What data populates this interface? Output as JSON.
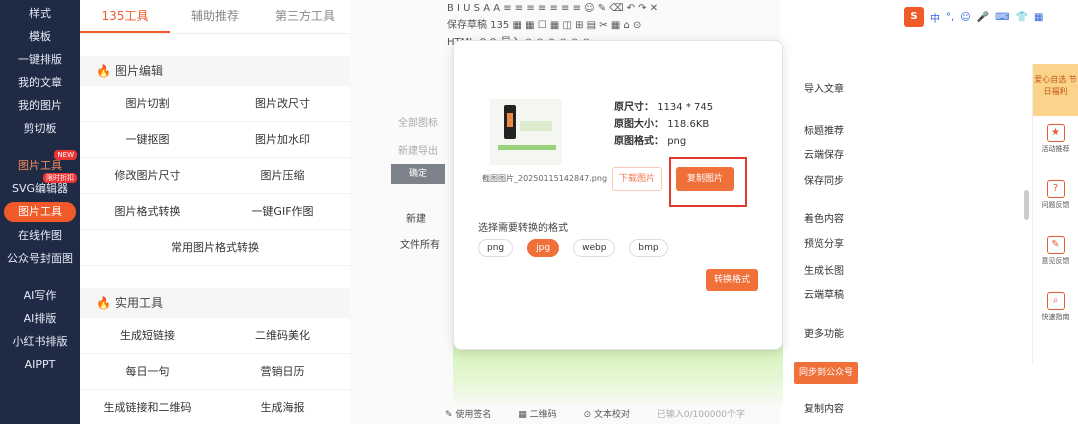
{
  "sidebar": {
    "items_top": [
      "样式",
      "模板",
      "一键排版",
      "我的文章",
      "我的图片",
      "剪切板"
    ],
    "item_hot": "图片工具",
    "badge_hot": "NEW",
    "item_svg": "SVG编辑器",
    "badge_svg": "限时折扣",
    "item_active": "图片工具",
    "item_after": [
      "在线作图",
      "公众号封面图"
    ],
    "items_bottom": [
      "AI写作",
      "AI排版",
      "小红书排版",
      "AIPPT"
    ]
  },
  "tools_panel": {
    "tabs": [
      "135工具",
      "辅助推荐",
      "第三方工具"
    ],
    "section_image": "图片编辑",
    "image_tools": [
      "图片切割",
      "图片改尺寸",
      "一键抠图",
      "图片加水印",
      "修改图片尺寸",
      "图片压缩",
      "图片格式转换",
      "一键GIF作图"
    ],
    "image_tools_wide": "常用图片格式转换",
    "section_practical": "实用工具",
    "practical_tools": [
      "生成短链接",
      "二维码美化",
      "每日一句",
      "营销日历",
      "生成链接和二维码",
      "生成海报"
    ]
  },
  "toolbar": {
    "row1": "B  I  U  S  A  A  ≡  ≡  ≡  ≡  ≡  ≡  ≡  ☺  ✎  ⌫  ↶  ↷  ✕",
    "row2": "保存草稿  135  ▦  ▦  ☐  ▦  ◫  ⊞  ▤  ✂  ▦  ⌂  ⊙",
    "row3": "HTML  ↶  ↷  导入  ⊙  ⊙  ⊕  ⊗  ⊘  ⊙"
  },
  "editor_side": {
    "faint1": "全部图标",
    "faint2": "新建导出",
    "gray_button": "确定",
    "label1": "新建",
    "label2": "文件所有"
  },
  "dialog": {
    "image_filename": "截图图片_20250115142847.png",
    "size_label": "原尺寸：",
    "size_value": "1134 * 745",
    "filesize_label": "原图大小：",
    "filesize_value": "118.6KB",
    "format_label": "原图格式：",
    "format_value": "png",
    "download_button": "下载图片",
    "copy_button": "复制图片",
    "choose_format_label": "选择需要转换的格式",
    "formats": [
      "png",
      "jpg",
      "webp",
      "bmp"
    ],
    "selected_format": "jpg",
    "convert_button": "转换格式"
  },
  "statusbar": {
    "items": [
      "使用签名",
      "二维码",
      "文本校对",
      "已输入0/100000个字"
    ]
  },
  "right_col": {
    "links": [
      "导入文章",
      "标题推荐",
      "云端保存",
      "保存同步",
      "着色内容",
      "预览分享",
      "生成长图",
      "云端草稿",
      "更多功能"
    ],
    "sync_button": "同步到公众号",
    "bottom_link": "复制内容"
  },
  "ime": {
    "logo": "S",
    "items": [
      "中",
      "°,",
      "☺",
      "🎤",
      "⌨",
      "👕",
      "▦"
    ]
  },
  "float_panel": {
    "top_text": "爱心自选 节日福利",
    "items": [
      "活动推荐",
      "问题反馈",
      "意见反馈",
      "快速指南"
    ]
  }
}
